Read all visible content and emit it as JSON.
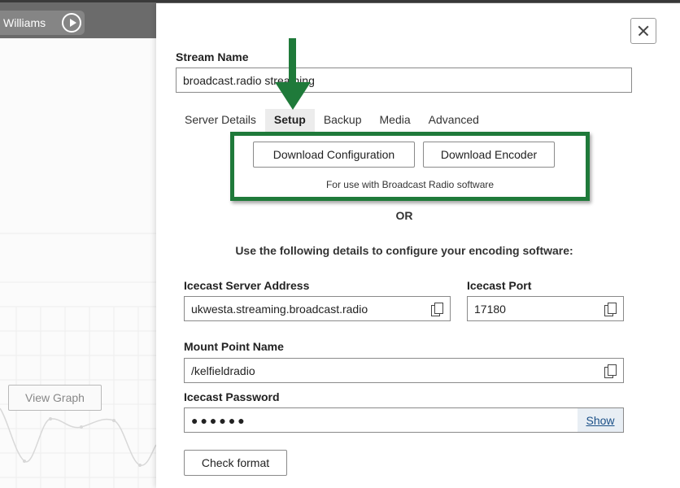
{
  "background": {
    "user_name": "Williams",
    "view_graph_label": "View Graph"
  },
  "stream": {
    "name_label": "Stream Name",
    "name_value": "broadcast.radio streaming"
  },
  "tabs": [
    {
      "label": "Server Details",
      "active": false
    },
    {
      "label": "Setup",
      "active": true
    },
    {
      "label": "Backup",
      "active": false
    },
    {
      "label": "Media",
      "active": false
    },
    {
      "label": "Advanced",
      "active": false
    }
  ],
  "setup": {
    "download_config_label": "Download Configuration",
    "download_encoder_label": "Download Encoder",
    "download_note": "For use with Broadcast Radio software",
    "or_text": "OR",
    "instructions": "Use the following details to configure your encoding software:",
    "server_address_label": "Icecast Server Address",
    "server_address_value": "ukwesta.streaming.broadcast.radio",
    "port_label": "Icecast Port",
    "port_value": "17180",
    "mount_label": "Mount Point Name",
    "mount_value": "/kelfieldradio",
    "password_label": "Icecast Password",
    "password_value": "●●●●●●",
    "show_label": "Show",
    "check_format_label": "Check format"
  },
  "colors": {
    "highlight": "#1f7a3a",
    "topbar": "#6b6b6b",
    "link": "#1a4f87"
  }
}
